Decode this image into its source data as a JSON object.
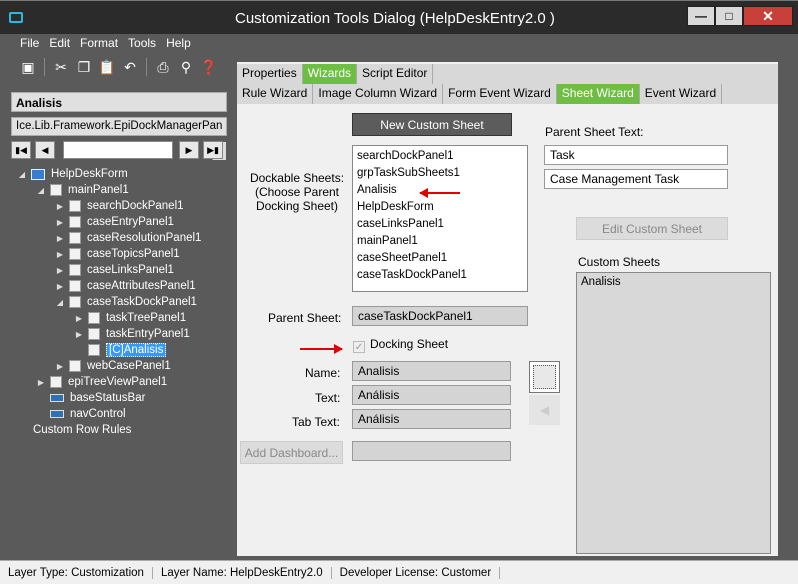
{
  "window": {
    "title": "Customization Tools Dialog  (HelpDeskEntry2.0 )"
  },
  "menu": [
    "File",
    "Edit",
    "Format",
    "Tools",
    "Help"
  ],
  "left": {
    "header": "Analisis",
    "path": "Ice.Lib.Framework.EpiDockManagerPan",
    "tree": [
      {
        "label": "HelpDeskForm",
        "level": 0,
        "icon": "form",
        "exp": "open"
      },
      {
        "label": "mainPanel1",
        "level": 1,
        "icon": "box",
        "exp": "open"
      },
      {
        "label": "searchDockPanel1",
        "level": 2,
        "icon": "box",
        "exp": "closed"
      },
      {
        "label": "caseEntryPanel1",
        "level": 2,
        "icon": "box",
        "exp": "closed"
      },
      {
        "label": "caseResolutionPanel1",
        "level": 2,
        "icon": "box",
        "exp": "closed"
      },
      {
        "label": "caseTopicsPanel1",
        "level": 2,
        "icon": "box",
        "exp": "closed"
      },
      {
        "label": "caseLinksPanel1",
        "level": 2,
        "icon": "box",
        "exp": "closed"
      },
      {
        "label": "caseAttributesPanel1",
        "level": 2,
        "icon": "box",
        "exp": "closed"
      },
      {
        "label": "caseTaskDockPanel1",
        "level": 2,
        "icon": "box",
        "exp": "open"
      },
      {
        "label": "taskTreePanel1",
        "level": 3,
        "icon": "box",
        "exp": "closed"
      },
      {
        "label": "taskEntryPanel1",
        "level": 3,
        "icon": "box",
        "exp": "closed"
      },
      {
        "label": "[C]Analisis",
        "level": 3,
        "icon": "box",
        "exp": "none",
        "selected": true
      },
      {
        "label": "webCasePanel1",
        "level": 2,
        "icon": "box",
        "exp": "closed"
      },
      {
        "label": "epiTreeViewPanel1",
        "level": 1,
        "icon": "box",
        "exp": "closed"
      },
      {
        "label": "baseStatusBar",
        "level": 1,
        "icon": "bar",
        "exp": "none"
      },
      {
        "label": "navControl",
        "level": 1,
        "icon": "bar",
        "exp": "none"
      },
      {
        "label": "Custom Row Rules",
        "level": 0,
        "icon": "none",
        "exp": "none"
      }
    ]
  },
  "tabs_top": [
    {
      "label": "Properties",
      "active": false
    },
    {
      "label": "Wizards",
      "active": true
    },
    {
      "label": "Script Editor",
      "active": false
    }
  ],
  "tabs_sub": [
    {
      "label": "Rule Wizard",
      "active": false
    },
    {
      "label": "Image Column Wizard",
      "active": false
    },
    {
      "label": "Form Event Wizard",
      "active": false
    },
    {
      "label": "Sheet Wizard",
      "active": true
    },
    {
      "label": "Event Wizard",
      "active": false
    }
  ],
  "sheet": {
    "new_button": "New Custom Sheet",
    "dockable_label": "Dockable Sheets:\n(Choose Parent\nDocking Sheet)",
    "dockable_items": [
      "searchDockPanel1",
      "grpTaskSubSheets1",
      "Analisis",
      "HelpDeskForm",
      "caseLinksPanel1",
      "mainPanel1",
      "caseSheetPanel1",
      "caseTaskDockPanel1"
    ],
    "parent_sheet_label": "Parent Sheet:",
    "parent_sheet_value": "caseTaskDockPanel1",
    "docking_label": "Docking Sheet",
    "name_label": "Name:",
    "name_value": "Analisis",
    "text_label": "Text:",
    "text_value": "Análisis",
    "tabtext_label": "Tab Text:",
    "tabtext_value": "Análisis",
    "add_dashboard": "Add Dashboard...",
    "parent_text_label": "Parent Sheet Text:",
    "parent_text_1": "Task",
    "parent_text_2": "Case Management Task",
    "edit_button": "Edit Custom Sheet",
    "custom_label": "Custom Sheets",
    "custom_items": [
      "Analisis"
    ]
  },
  "status": {
    "layer_type": "Layer Type:  Customization",
    "layer_name": "Layer Name:  HelpDeskEntry2.0",
    "license": "Developer License:  Customer"
  }
}
